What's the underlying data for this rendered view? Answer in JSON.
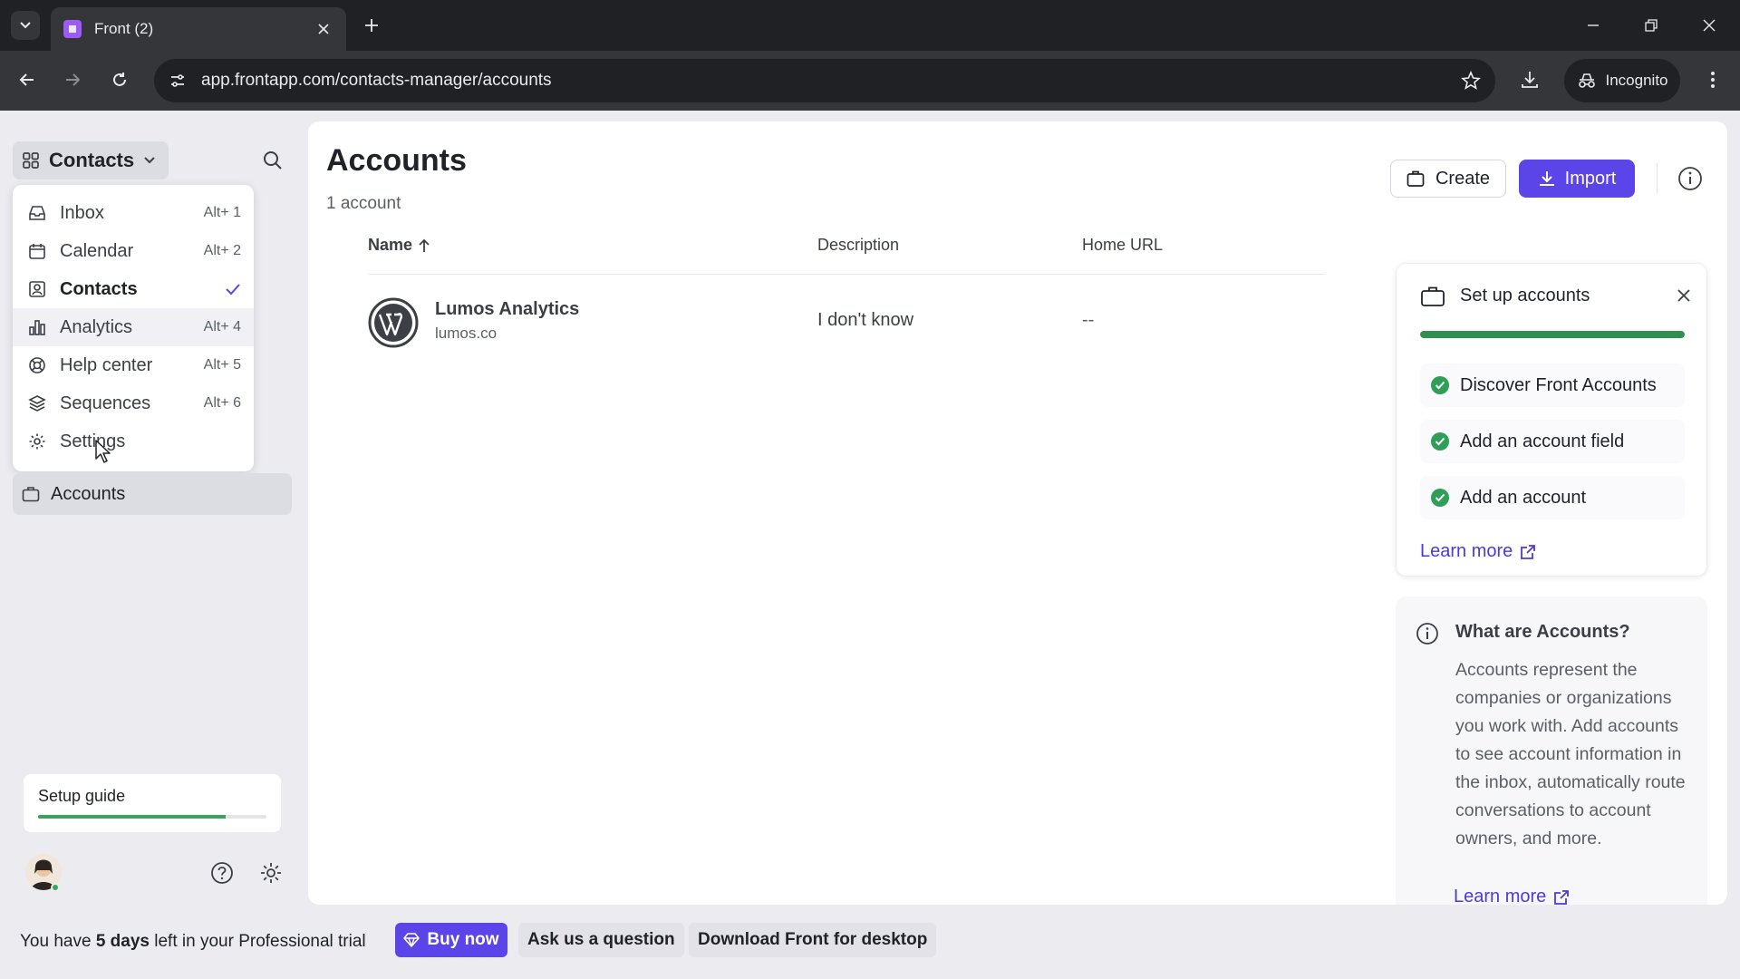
{
  "browser": {
    "tab_title": "Front (2)",
    "url": "app.frontapp.com/contacts-manager/accounts",
    "profile_label": "Incognito"
  },
  "sidebar": {
    "switcher_label": "Contacts",
    "menu": [
      {
        "label": "Inbox",
        "shortcut": "Alt+ 1",
        "icon": "inbox-icon"
      },
      {
        "label": "Calendar",
        "shortcut": "Alt+ 2",
        "icon": "calendar-icon"
      },
      {
        "label": "Contacts",
        "shortcut": "",
        "icon": "contacts-icon",
        "active": true
      },
      {
        "label": "Analytics",
        "shortcut": "Alt+ 4",
        "icon": "analytics-icon"
      },
      {
        "label": "Help center",
        "shortcut": "Alt+ 5",
        "icon": "help-center-icon"
      },
      {
        "label": "Sequences",
        "shortcut": "Alt+ 6",
        "icon": "sequences-icon"
      },
      {
        "label": "Settings",
        "shortcut": "",
        "icon": "settings-icon"
      }
    ],
    "accounts_label": "Accounts",
    "setup_guide_label": "Setup guide",
    "setup_guide_progress": 0.82
  },
  "main": {
    "title": "Accounts",
    "count_text": "1 account",
    "create_label": "Create",
    "import_label": "Import",
    "table": {
      "headers": {
        "name": "Name",
        "description": "Description",
        "home_url": "Home URL"
      },
      "rows": [
        {
          "name": "Lumos Analytics",
          "domain": "lumos.co",
          "description": "I don't know",
          "home_url": "--"
        }
      ]
    }
  },
  "setup_card": {
    "title": "Set up accounts",
    "progress": 1.0,
    "tasks": [
      "Discover Front Accounts",
      "Add an account field",
      "Add an account"
    ],
    "learn_more": "Learn more"
  },
  "about_card": {
    "title": "What are Accounts?",
    "body": "Accounts represent the companies or organizations you work with. Add accounts to see account information in the inbox, automatically route conversations to account owners, and more.",
    "learn_more": "Learn more"
  },
  "trial": {
    "prefix": "You have ",
    "days": "5 days",
    "suffix": " left in your Professional trial",
    "buy_label": "Buy now",
    "ask_label": "Ask us a question",
    "download_label": "Download Front for desktop"
  },
  "colors": {
    "brand": "#5b45e8",
    "success": "#2f9e57"
  }
}
